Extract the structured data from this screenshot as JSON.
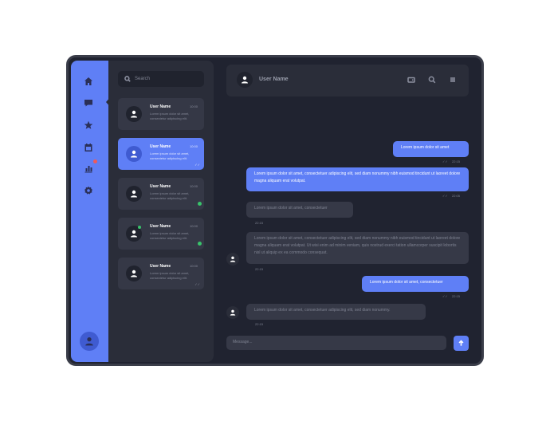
{
  "sidebar": {
    "icons": [
      "home-icon",
      "chat-icon",
      "star-icon",
      "calendar-icon",
      "chart-icon",
      "gear-icon"
    ],
    "active": "chat-icon",
    "notification_dot_color": "#ef5a5a"
  },
  "search": {
    "placeholder": "Search"
  },
  "chats": [
    {
      "name": "User Name",
      "time": "10:00",
      "preview": "Lorem ipsum dolor sit amet, consectetur adipiscing elit.",
      "selected": false
    },
    {
      "name": "User Name",
      "time": "10:00",
      "preview": "Lorem ipsum dolor sit amet, consectetur adipiscing elit.",
      "selected": true,
      "tick": "✓✓"
    },
    {
      "name": "User Name",
      "time": "10:00",
      "preview": "Lorem ipsum dolor sit amet, consectetur adipiscing elit.",
      "selected": false,
      "unread": true
    },
    {
      "name": "User Name",
      "time": "10:00",
      "preview": "Lorem ipsum dolor sit amet, consectetur adipiscing elit.",
      "selected": false,
      "online": true,
      "unread": true
    },
    {
      "name": "User Name",
      "time": "10:00",
      "preview": "Lorem ipsum dolor sit amet, consectetur adipiscing elit.",
      "selected": false,
      "tick": "✓✓"
    }
  ],
  "header": {
    "title": "User Name",
    "icons": [
      "card-icon",
      "search-icon",
      "menu-icon"
    ]
  },
  "messages": [
    {
      "dir": "out",
      "text": "Lorem ipsum dolor sit amet",
      "time": "22:15",
      "tick": "✓✓"
    },
    {
      "dir": "out",
      "text": "Lorem ipsum dolor sit amet, consectetuer adipiscing elit, sed diam nonummy nibh euismod tincidunt ut laoreet dolore magna aliquam erat volutpat.",
      "time": "22:05",
      "tick": "✓✓"
    },
    {
      "dir": "in",
      "text": "Lorem ipsum dolor sit amet, consectetuer",
      "time": "22:15"
    },
    {
      "dir": "in",
      "text": "Lorem ipsum dolor sit amet, consectetuer adipiscing elit, sed diam nonummy nibh euismod tincidunt ut laoreet dolore magna aliquam erat volutpat. Ut wisi enim ad minim veniam, quis nostrud exerci tation ullamcorper suscipit lobortis nisl ut aliquip ex ea commodo consequat.",
      "time": "22:15"
    },
    {
      "dir": "out",
      "text": "Lorem ipsum dolor sit amet, consectetuer",
      "time": "22:15",
      "tick": "✓✓"
    },
    {
      "dir": "in",
      "text": "Lorem ipsum dolor sit amet, consectetuer adipiscing elit, sed diam nonummy.",
      "time": "22:15"
    }
  ],
  "composer": {
    "placeholder": "Message..."
  },
  "colors": {
    "accent": "#5f7ff6",
    "background": "#202330",
    "panel": "#2a2d39",
    "online": "#39c36b"
  }
}
